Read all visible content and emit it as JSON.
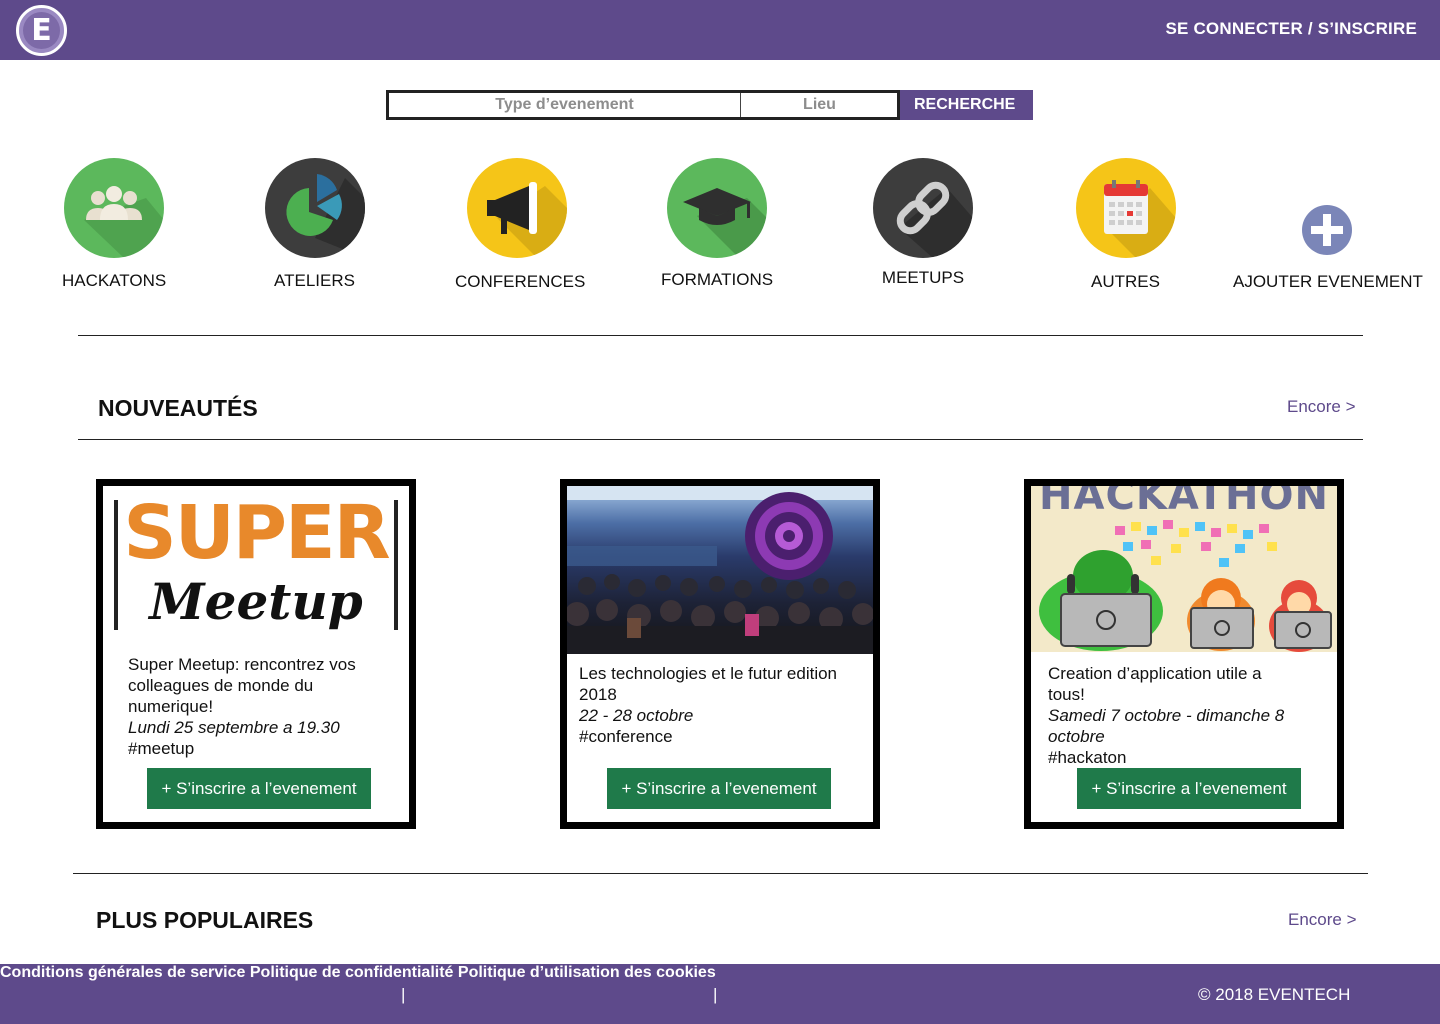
{
  "header": {
    "logo_letter": "E",
    "login_label": "SE CONNECTER / S’INSCRIRE"
  },
  "search": {
    "type_placeholder": "Type d’evenement",
    "place_placeholder": "Lieu",
    "button_label": "RECHERCHE"
  },
  "categories": [
    {
      "label": "HACKATONS",
      "icon": "people-icon",
      "color": "#5cb85c"
    },
    {
      "label": "ATELIERS",
      "icon": "pie-chart-icon",
      "color": "#3d3d3d"
    },
    {
      "label": "CONFERENCES",
      "icon": "megaphone-icon",
      "color": "#f5c518"
    },
    {
      "label": "FORMATIONS",
      "icon": "graduation-cap-icon",
      "color": "#5cb85c"
    },
    {
      "label": "MEETUPS",
      "icon": "link-icon",
      "color": "#3d3d3d"
    },
    {
      "label": "AUTRES",
      "icon": "calendar-icon",
      "color": "#f5c518"
    },
    {
      "label": "AJOUTER EVENEMENT",
      "icon": "plus-circle-icon",
      "color": "#7b86b8"
    }
  ],
  "nouveautes": {
    "title": "NOUVEAUTÉS",
    "more_label": "Encore >",
    "cards": [
      {
        "image_text_1": "SUPER",
        "image_text_2": "Meetup",
        "title": "Super Meetup: rencontrez vos colleagues de monde du numerique!",
        "date": "Lundi 25 septembre a 19.30",
        "tag": "#meetup",
        "button_label": "+ S’inscrire a l’evenement"
      },
      {
        "title": "Les technologies et le futur edition 2018",
        "date": "22 - 28 octobre",
        "tag": "#conference",
        "button_label": "+ S’inscrire a l’evenement"
      },
      {
        "image_text_1": "HACKATHON",
        "title": "Creation d’application utile a tous!",
        "date": "Samedi 7 octobre - dimanche 8 octobre",
        "tag": "#hackaton",
        "button_label": "+ S’inscrire a l’evenement"
      }
    ]
  },
  "populaires": {
    "title": "PLUS POPULAIRES",
    "more_label": "Encore >"
  },
  "footer": {
    "terms": "Conditions générales de service",
    "sep1": "|",
    "privacy": "Politique de confidentialité",
    "sep2": "|",
    "cookies": "Politique d’utilisation des cookies",
    "copyright": "© 2018 EVENTECH"
  },
  "colors": {
    "brand_purple": "#5e4a8b",
    "button_green": "#1f7a4a"
  }
}
